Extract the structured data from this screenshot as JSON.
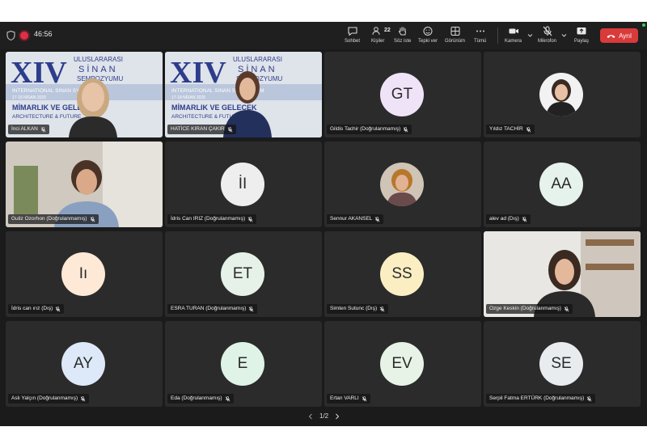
{
  "timer": "46:56",
  "toolbar": {
    "chat": "Sohbet",
    "people": "Kişiler",
    "people_count": "22",
    "raise": "Söz iste",
    "react": "Tepki ver",
    "view": "Görünüm",
    "more": "Tümü",
    "camera": "Kamera",
    "mic": "Mikrofon",
    "share": "Paylaş",
    "leave": "Ayrıl"
  },
  "banner": {
    "roman": "XIV",
    "line1": "ULUSLARARASI",
    "line2": "SİNAN",
    "line3": "SEMPOZYUMU",
    "line4": "INTERNATIONAL SINAN SYMPOSIUM",
    "date": "17-18 NİSAN 2025",
    "line5": "MİMARLIK VE GELECEK",
    "line6": "ARCHITECTURE & FUTURE"
  },
  "colors": {
    "accent": "#7a7fe6",
    "leave": "#d93a3a",
    "tile": "#2b2b2b"
  },
  "tiles": [
    {
      "name": "İnci ALKAN",
      "kind": "video"
    },
    {
      "name": "HATİCE KIRAN ÇAKIR",
      "kind": "video"
    },
    {
      "name": "Gildis Tachir (Doğrulanmamış)",
      "initials": "GT",
      "color": "#efe4f7"
    },
    {
      "name": "Yıldız TACHİR",
      "kind": "photo"
    },
    {
      "name": "Guliz Ozorhon (Doğrulanmamış)",
      "kind": "video"
    },
    {
      "name": "İdris Can IRIZ (Doğrulanmamış)",
      "initials": "İI",
      "color": "#eeeeee"
    },
    {
      "name": "Sennur AKANSEL",
      "kind": "photo"
    },
    {
      "name": "alev ad (Dış)",
      "initials": "AA",
      "color": "#e6f3ec"
    },
    {
      "name": "İdris can ırız (Dış)",
      "initials": "Iı",
      "color": "#fde9d6"
    },
    {
      "name": "ESRA TURAN (Doğrulanmamış)",
      "initials": "ET",
      "color": "#e6f2e8"
    },
    {
      "name": "Simten Sutunc (Dış)",
      "initials": "SS",
      "color": "#fbeec3"
    },
    {
      "name": "Ozge Keskin (Doğrulanmamış)",
      "kind": "video"
    },
    {
      "name": "Aslı Yalçın (Doğrulanmamış)",
      "initials": "AY",
      "color": "#dde9f8"
    },
    {
      "name": "Eda (Doğrulanmamış)",
      "initials": "E",
      "color": "#dff3e6"
    },
    {
      "name": "Ertan VARLI",
      "initials": "EV",
      "color": "#e6f3e6"
    },
    {
      "name": "Serpil Fatma ERTÜRK (Doğrulanmamış)",
      "initials": "SE",
      "color": "#e9ecef"
    }
  ],
  "pager": {
    "label": "1/2"
  }
}
